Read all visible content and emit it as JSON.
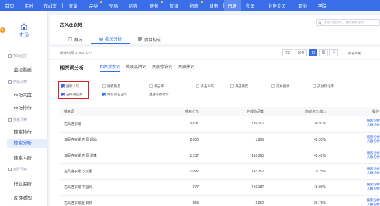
{
  "nav": {
    "items": [
      {
        "label": "首页",
        "dot": false,
        "active": false
      },
      {
        "label": "实时",
        "dot": false,
        "active": false
      },
      {
        "label": "作战室",
        "dot": false,
        "active": false
      },
      {
        "label": "流量",
        "dot": false,
        "active": false
      },
      {
        "label": "品类",
        "dot": true,
        "active": false
      },
      {
        "label": "交易",
        "dot": false,
        "active": false
      },
      {
        "label": "内容",
        "dot": false,
        "active": false
      },
      {
        "label": "服务",
        "dot": true,
        "active": false
      },
      {
        "label": "营销",
        "dot": false,
        "active": false
      },
      {
        "label": "物流",
        "dot": true,
        "active": false
      },
      {
        "label": "财务",
        "dot": false,
        "active": false
      },
      {
        "label": "市场",
        "dot": false,
        "active": true
      },
      {
        "label": "竞争",
        "dot": false,
        "active": false
      },
      {
        "label": "业务专区",
        "dot": false,
        "active": false
      },
      {
        "label": "取数",
        "dot": false,
        "active": false
      },
      {
        "label": "学院",
        "dot": false,
        "active": false
      }
    ],
    "accent": "#3a6ee8"
  },
  "sidebar": {
    "home_label": "市场",
    "home_icon": "market-icon",
    "avatar_text": "0",
    "groups": [
      "市场监控",
      "供给洞察",
      "搜索洞察",
      "客群洞察"
    ],
    "links": [
      "监控看板",
      "市场大盘",
      "市场排行",
      "搜索排行",
      "搜索分析",
      "搜索人群",
      "行业客群",
      "客群透视"
    ],
    "active_link": "搜索分析"
  },
  "header": {
    "shop_title": "古风连衣裙",
    "search_placeholder": "请输入搜索词，进行搜索分析",
    "tabs": [
      {
        "label": "概况",
        "icon": "document-icon",
        "active": false
      },
      {
        "label": "相关分析",
        "icon": "link-icon",
        "active": true
      },
      {
        "label": "类目构成",
        "icon": "category-icon",
        "active": false
      }
    ]
  },
  "date_row": {
    "stat_time": "统计时间 2019-07-22",
    "buttons": [
      "7天",
      "30天",
      "日",
      "周",
      "月"
    ],
    "active_button": "日",
    "terminal": "所有终端"
  },
  "analysis": {
    "title": "相关词分析",
    "tabs": [
      "相关搜索词",
      "关联品牌词",
      "关联修饰词",
      "关联热词"
    ],
    "active_tab": "相关搜索词",
    "checkboxes": [
      {
        "label": "搜索人气",
        "checked": true
      },
      {
        "label": "搜索热度",
        "checked": false
      },
      {
        "label": "点击率",
        "checked": false
      },
      {
        "label": "点击人气",
        "checked": false
      },
      {
        "label": "点击热度",
        "checked": false
      },
      {
        "label": "交易指数",
        "checked": false
      },
      {
        "label": "支付转化率",
        "checked": false
      },
      {
        "label": "在线商品数",
        "checked": true
      },
      {
        "label": "商城点击占比",
        "checked": true
      },
      {
        "label": "直通车参考价",
        "checked": false
      }
    ],
    "table": {
      "headers": [
        "搜索词",
        "搜索人气",
        "在线商品数",
        "商城点击占比",
        "操作"
      ],
      "rows": [
        {
          "term": "古风连衣裙",
          "popularity": "5,831",
          "products": "735,016",
          "ratio": "36.97%"
        },
        {
          "term": "汉服连衣裙 古风 超仙",
          "popularity": "2,000",
          "products": "1,866",
          "ratio": "45.93%"
        },
        {
          "term": "汉服连衣裙 古风 夏季",
          "popularity": "1,737",
          "products": "110,365",
          "ratio": "45.42%"
        },
        {
          "term": "古风连衣裙 汉元素",
          "popularity": "1,092",
          "products": "147,312",
          "ratio": "19.25%"
        },
        {
          "term": "古风连衣裙 中国风",
          "popularity": "977",
          "products": "450,187",
          "ratio": "48.96%"
        },
        {
          "term": "古风连衣裙夏 日常",
          "popularity": "953",
          "products": "2,052",
          "ratio": "26.78%"
        }
      ],
      "op_search": "搜索分析",
      "op_people": "人群分析"
    }
  }
}
